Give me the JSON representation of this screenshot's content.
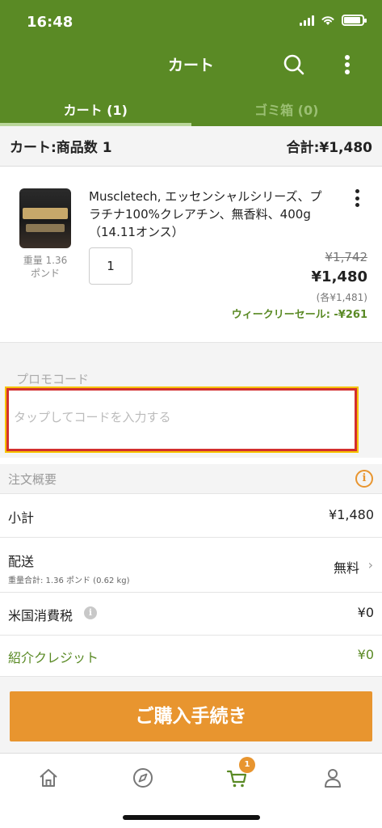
{
  "status_bar": {
    "time": "16:48"
  },
  "header": {
    "title": "カート"
  },
  "tabs": [
    {
      "label": "カート (1)",
      "active": true
    },
    {
      "label": "ゴミ箱 (0)",
      "active": false
    }
  ],
  "summary": {
    "left": "カート:商品数 1",
    "right": "合計:¥1,480"
  },
  "product": {
    "image": "creatine-container",
    "weight_line1": "重量 1.36",
    "weight_line2": "ポンド",
    "name": "Muscletech, エッセンシャルシリーズ、プラチナ100%クレアチン、無香料、400g（14.11オンス）",
    "quantity": "1",
    "original_price": "¥1,742",
    "price": "¥1,480",
    "price_each": "(各¥1,481)",
    "weekly_sale": "ウィークリーセール: -¥261"
  },
  "promo": {
    "label": "プロモコード",
    "placeholder": "タップしてコードを入力する"
  },
  "order_summary": {
    "title": "注文概要",
    "subtotal_label": "小計",
    "subtotal_value": "¥1,480",
    "shipping_label": "配送",
    "shipping_sub": "重量合計: 1.36 ポンド (0.62 kg)",
    "shipping_value": "無料",
    "tax_label": "米国消費税",
    "tax_value": "¥0",
    "credit_label": "紹介クレジット",
    "credit_value": "¥0"
  },
  "checkout": {
    "label": "ご購入手続き"
  },
  "bottom_nav": {
    "cart_badge": "1"
  },
  "colors": {
    "brand_green": "#5a8a25",
    "accent_orange": "#e8952f",
    "highlight_red": "#d32f2f"
  }
}
